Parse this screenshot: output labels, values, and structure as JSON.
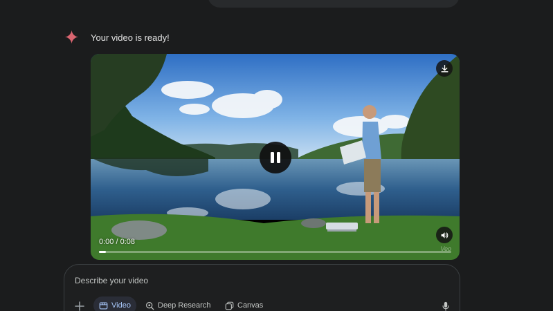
{
  "colors": {
    "background": "#1b1c1d",
    "accent_active": "#a8c7fa",
    "spark": "#d96570"
  },
  "response": {
    "icon": "gemini-spark-icon",
    "text": "Your video is ready!"
  },
  "video_player": {
    "time_display": "0:00 / 0:08",
    "progress_fraction": 0.02,
    "state": "playing",
    "watermark": "Veo",
    "icons": [
      "download-icon",
      "pause-icon",
      "volume-icon"
    ]
  },
  "composer": {
    "placeholder": "Describe your video",
    "tools": [
      {
        "label": "Video",
        "icon": "video-icon",
        "active": true
      },
      {
        "label": "Deep Research",
        "icon": "deep-research-icon",
        "active": false
      },
      {
        "label": "Canvas",
        "icon": "canvas-icon",
        "active": false
      }
    ],
    "icons": [
      "plus-icon",
      "mic-icon"
    ]
  }
}
